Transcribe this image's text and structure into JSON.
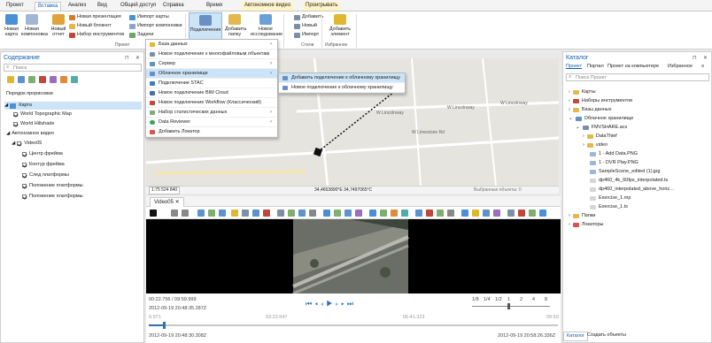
{
  "ribbon_tabs": [
    "Проект",
    "Вставка",
    "Анализ",
    "Вид",
    "Общий доступ",
    "Справка",
    "Время",
    "Автономное видео",
    "Проигрывать"
  ],
  "ribbon": {
    "new_map": "Новая карта",
    "new_layout": "Новая компоновка",
    "new_report": "Новый отчет",
    "new_presentation": "Новая презентация",
    "new_notebook": "Новый блокнот",
    "toolbox": "Набор инструментов",
    "tasks": "Задачи",
    "import_map": "Импорт карты",
    "import_layout": "Импорт компоновки",
    "connections": "Подключения",
    "add_folder": "Добавить папку",
    "new_study": "Новое исследование",
    "add": "Добавить",
    "new": "Новый",
    "import": "Импорт",
    "add_element": "Добавить элемент",
    "group_project": "Проект",
    "group_styles": "Стили",
    "group_favorites": "Избранное"
  },
  "contents": {
    "title": "Содержание",
    "search_placeholder": "Поиск",
    "draw_order": "Порядок прорисовки",
    "map_name": "Карта",
    "layer_topo": "World Topographic Map",
    "layer_hillshade": "World Hillshade",
    "autonomous_video": "Автономное видео",
    "video_name": "Video05",
    "sublayers": [
      "Центр фрейма",
      "Контур фрейма",
      "След платформы",
      "Положение платформы",
      "Положение платформы"
    ]
  },
  "menu": {
    "items": [
      "База данных",
      "Новое подключение к многофайловым объектам",
      "Сервер",
      "Облачное хранилище",
      "Подключение STAC",
      "Новое подключение BIM Cloud",
      "Новое подключение Workflow (Классический)",
      "Набор статистических данных",
      "Data Reviewer",
      "Добавить Локатор"
    ],
    "sub_items": [
      "Добавить подключение к облачному хранилищу",
      "Новое подключение к облачному хранилищу"
    ]
  },
  "map": {
    "scale": "1:75 524 840",
    "coords": "34,4653890°E 34,7497065°C",
    "selected": "Выбранные объекты: 0",
    "roads": [
      "W Limestone Rd",
      "W Lincolnway",
      "W Lincolnway",
      "W Lincolnway"
    ]
  },
  "video": {
    "tab_title": "Video05",
    "elapsed": "00:22.756 / 09:59.999",
    "timestamp": "2012-09-19 20:48:35.287Z",
    "tick_start": "0.971",
    "tick_mid1": "03:22.647",
    "tick_mid2": "06:41.323",
    "tick_end": "09:59",
    "start_time": "2012-09-19 20:48:30.308Z",
    "end_time": "2012-09-19 20:58:26.336Z",
    "speeds": [
      "1/8",
      "1/4",
      "1/2",
      "1",
      "2",
      "4",
      "8"
    ]
  },
  "catalog": {
    "title": "Каталог",
    "tabs": [
      "Проект",
      "Портал",
      "Проект на компьютере",
      "Избранное"
    ],
    "search_placeholder": "Поиск Проект",
    "items": [
      "Карты",
      "Наборы инструментов",
      "Базы данных",
      "Облачное хранилище",
      "FMVSHARE.acs",
      "DataThief",
      "video",
      "1 - Add Data.PNG",
      "1 - DVR Play.PNG",
      "SampleScene_edited (1).jpg",
      "dp460_4k_60fps_interpolated.ts",
      "dp460_interpolated_above_horiz…",
      "Exercise_1.mp",
      "Exercise_1.ts",
      "Папки",
      "Локаторы"
    ],
    "bottom_tabs": [
      "Каталог",
      "Создать объекты"
    ]
  }
}
